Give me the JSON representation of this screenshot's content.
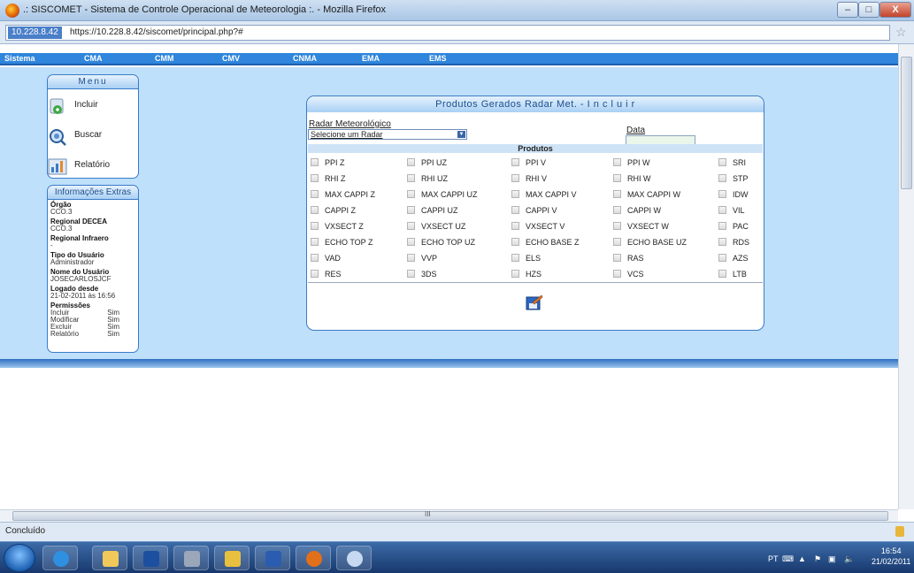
{
  "window": {
    "title": ".: SISCOMET - Sistema de Controle Operacional de Meteorologia :. - Mozilla Firefox",
    "min": "–",
    "max": "□",
    "close": "X"
  },
  "address": {
    "badge": "10.228.8.42",
    "url": "https://10.228.8.42/siscomet/principal.php?#"
  },
  "nav": [
    "Sistema",
    "CMA",
    "CMM",
    "CMV",
    "CNMA",
    "EMA",
    "EMS"
  ],
  "menu": {
    "title": "Menu",
    "items": [
      {
        "label": "Incluir",
        "icon": "plant-add-icon"
      },
      {
        "label": "Buscar",
        "icon": "magnifier-icon"
      },
      {
        "label": "Relatório",
        "icon": "chart-icon"
      }
    ]
  },
  "info": {
    "title": "Informações Extras",
    "fields": [
      {
        "label": "Órgão",
        "value": "CCO.3"
      },
      {
        "label": "Regional DECEA",
        "value": "CCO.3"
      },
      {
        "label": "Regional Infraero",
        "value": "-"
      },
      {
        "label": "Tipo do Usuário",
        "value": "Administrador"
      },
      {
        "label": "Nome do Usuário",
        "value": "JOSECARLOSJCF"
      },
      {
        "label": "Logado desde",
        "value": "21-02-2011 às 16:56"
      }
    ],
    "perm_label": "Permissões",
    "permissions": [
      {
        "name": "Incluir",
        "value": "Sim"
      },
      {
        "name": "Modificar",
        "value": "Sim"
      },
      {
        "name": "Excluir",
        "value": "Sim"
      },
      {
        "name": "Relatório",
        "value": "Sim"
      }
    ]
  },
  "form": {
    "title": "Produtos Gerados Radar Met. - I n c l u i r",
    "radar_label": "Radar Meteorológico",
    "radar_selected": "Selecione um Radar",
    "date_label": "Data",
    "date_value": "",
    "products_title": "Produtos",
    "columns": [
      [
        "PPI Z",
        "RHI Z",
        "MAX CAPPI Z",
        "CAPPI Z",
        "VXSECT Z",
        "ECHO TOP Z",
        "VAD",
        "RES"
      ],
      [
        "PPI UZ",
        "RHI UZ",
        "MAX CAPPI UZ",
        "CAPPI UZ",
        "VXSECT UZ",
        "ECHO TOP UZ",
        "VVP",
        "3DS"
      ],
      [
        "PPI V",
        "RHI V",
        "MAX CAPPI V",
        "CAPPI V",
        "VXSECT V",
        "ECHO BASE Z",
        "ELS",
        "HZS"
      ],
      [
        "PPI W",
        "RHI W",
        "MAX CAPPI W",
        "CAPPI W",
        "VXSECT W",
        "ECHO BASE UZ",
        "RAS",
        "VCS"
      ],
      [
        "SRI",
        "STP",
        "IDW",
        "VIL",
        "PAC",
        "RDS",
        "AZS",
        "LTB"
      ]
    ]
  },
  "status": {
    "text": "Concluído"
  },
  "taskbar": {
    "lang": "PT",
    "time": "16:54",
    "date": "21/02/2011"
  },
  "hscroll_grip": "III"
}
